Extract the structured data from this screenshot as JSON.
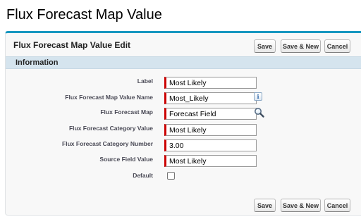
{
  "page": {
    "title": "Flux Forecast Map Value"
  },
  "panel": {
    "title": "Flux Forecast Map Value Edit",
    "buttons": {
      "save": "Save",
      "save_new": "Save & New",
      "cancel": "Cancel"
    }
  },
  "section": {
    "title": "Information"
  },
  "fields": {
    "label": {
      "label": "Label",
      "value": "Most Likely"
    },
    "name": {
      "label": "Flux Forecast Map Value Name",
      "value": "Most_Likely"
    },
    "map": {
      "label": "Flux Forecast Map",
      "value": "Forecast Field"
    },
    "category_value": {
      "label": "Flux Forecast Category Value",
      "value": "Most Likely"
    },
    "category_number": {
      "label": "Flux Forecast Category Number",
      "value": "3.00"
    },
    "source_field": {
      "label": "Source Field Value",
      "value": "Most Likely"
    },
    "default": {
      "label": "Default",
      "checked": false
    }
  },
  "icons": {
    "info": "info-icon",
    "lookup": "lookup-magnifier-icon"
  },
  "colors": {
    "accent": "#1797c0",
    "required": "#cc0000",
    "section_bg": "#d5e4ee"
  }
}
